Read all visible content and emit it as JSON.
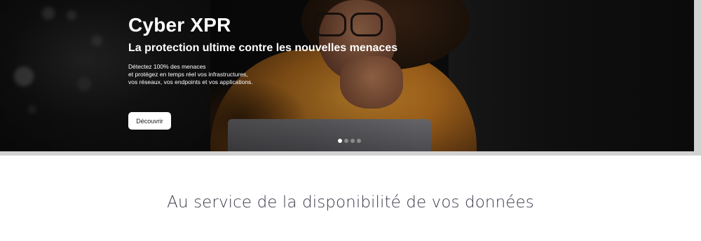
{
  "hero": {
    "title": "Cyber XPR",
    "subtitle": "La protection ultime contre les nouvelles menaces",
    "description_lines": [
      "Détectez 100% des menaces",
      "et protégez en temps réel vos infrastructures,",
      "vos réseaux, vos endpoints et vos applications."
    ],
    "cta_label": "Découvrir",
    "carousel": {
      "slide_count": 4,
      "active_index": 0
    }
  },
  "section": {
    "heading": "Au service de la disponibilité de vos données"
  },
  "colors": {
    "hero_background": "#0b0b0b",
    "button_background": "#ffffff",
    "heading_text": "#3a3a4a",
    "dot_active": "#ffffff",
    "dot_inactive": "#8a8a8a"
  }
}
